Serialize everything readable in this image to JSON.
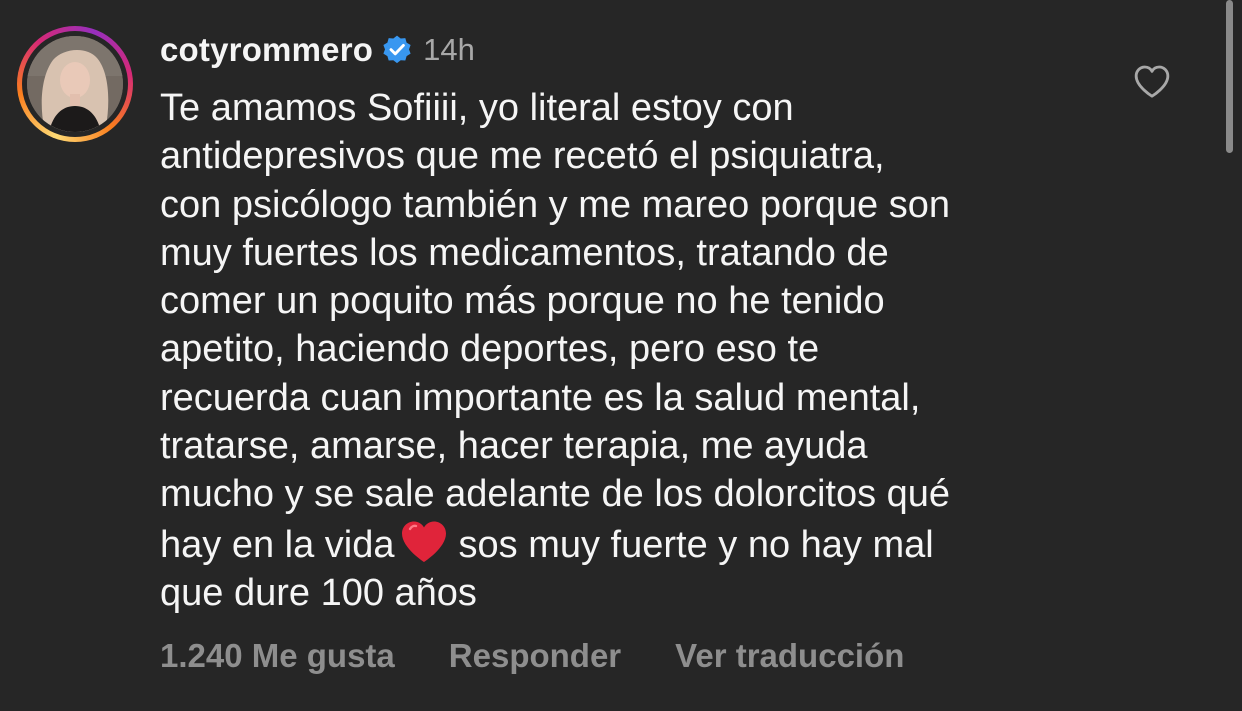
{
  "comment": {
    "username": "cotyrommero",
    "verified_icon": "verified-badge-icon",
    "timestamp": "14h",
    "lines": [
      "Te amamos Sofiiii, yo literal estoy con",
      "antidepresivos que me recetó el psiquiatra,",
      "con psicólogo también y me mareo porque son",
      "muy fuertes los medicamentos, tratando de",
      "comer un poquito más porque no he tenido",
      "apetito, haciendo deportes, pero eso te",
      "recuerda cuan importante es la salud mental,",
      "tratarse, amarse, hacer terapia, me ayuda",
      "mucho y se sale adelante de los dolorcitos qué"
    ],
    "line_with_emoji_before": "hay en la vida",
    "emoji": "red-heart-emoji",
    "line_with_emoji_after": "sos muy fuerte y no hay mal",
    "last_line": "que dure 100 años",
    "likes_label": "1.240 Me gusta",
    "reply_label": "Responder",
    "translate_label": "Ver traducción",
    "like_icon": "heart-outline-icon"
  },
  "colors": {
    "background": "#262626",
    "primary_text": "#f5f5f5",
    "secondary_text": "#a8a8a8",
    "action_text": "#8e8e8e",
    "verified_blue": "#3897f0",
    "heart_red": "#e0243a"
  }
}
